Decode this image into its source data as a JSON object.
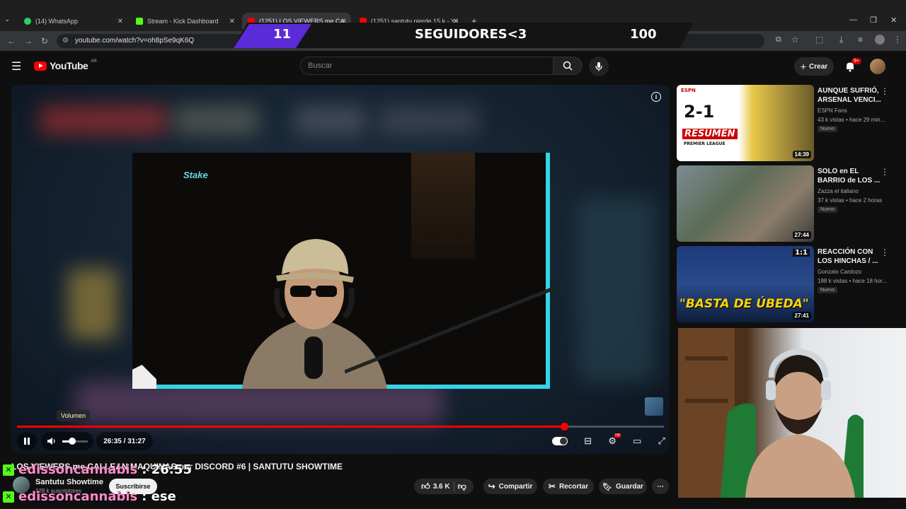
{
  "browser": {
    "tabs": [
      {
        "label": "(14) WhatsApp",
        "color": "#25d366"
      },
      {
        "label": "Stream - Kick Dashboard",
        "color": "#53fc18"
      },
      {
        "label": "(1251) LOS VIEWERS me CA",
        "color": "#ff0000"
      },
      {
        "label": "(1251) santutu pierde 15 k - Yo",
        "color": "#ff0000"
      }
    ],
    "url": "youtube.com/watch?v=oh8pSe9qK6Q"
  },
  "banner": {
    "count_left": "11",
    "label": "SEGUIDORES<3",
    "count_right": "100"
  },
  "youtube": {
    "logo": "YouTube",
    "region": "AR",
    "search_placeholder": "Buscar",
    "create_label": "Crear",
    "notif_count": "9+"
  },
  "player": {
    "time": "26:35 / 31:27",
    "progress": 0.846,
    "volume_tooltip": "Volumen",
    "watermark_text": "Stake"
  },
  "video": {
    "title": "LOS VIEWERS me CALLEAN MAQUINAS por DISCORD #6 | SANTUTU SHOWTIME",
    "channel": "Santutu Showtime",
    "subscribers": "128 k suscriptores",
    "subscribe_label": "Suscribirse",
    "likes": "3.6 K",
    "share_label": "Compartir",
    "clip_label": "Recortar",
    "save_label": "Guardar"
  },
  "chat": [
    {
      "user": "edissoncannabis",
      "message": ": 26:55"
    },
    {
      "user": "edissoncannabis",
      "message": ": ese"
    }
  ],
  "recommendations": [
    {
      "title": "AUNQUE SUFRIÓ, ARSENAL VENCI...",
      "channel": "ESPN Fans",
      "meta": "43 k vistas • hace 29 min...",
      "badge": "Nuevo",
      "duration": "14:39",
      "thumb_text": "2-1",
      "thumb_sub": "RESUMEN",
      "thumb_sub2": "PREMIER LEAGUE",
      "thumb_logo": "ESPN"
    },
    {
      "title": "SOLO en EL BARRIO de LOS ...",
      "channel": "Zazza el italiano",
      "meta": "37 k vistas • hace 2 horas",
      "badge": "Nuevo",
      "duration": "27:44"
    },
    {
      "title": "REACCIÓN CON LOS HINCHAS / ...",
      "channel": "Gonzalo Cardozo",
      "meta": "188 k vistas • hace 18 hor...",
      "badge": "Nuevo",
      "duration": "27:41",
      "thumb_text": "\"BASTA DE ÚBEDA\"",
      "thumb_score": "1:1"
    }
  ]
}
